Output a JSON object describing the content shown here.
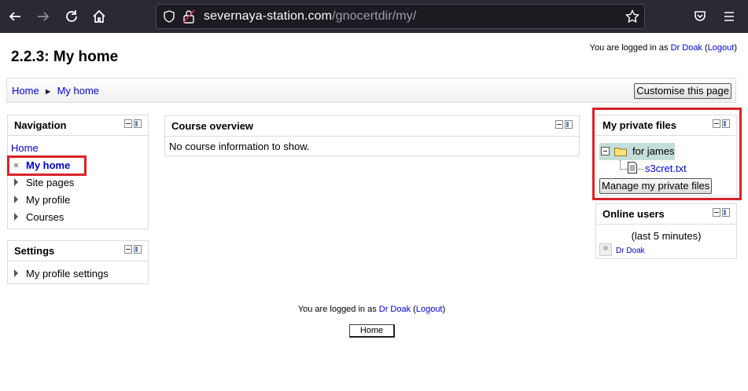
{
  "browser": {
    "url_host": "severnaya-station.com",
    "url_path": "/gnocertdir/my/",
    "icons": [
      "back-arrow-icon",
      "forward-arrow-icon",
      "reload-icon",
      "home-icon",
      "shield-icon",
      "lock-icon",
      "star-icon",
      "pocket-icon",
      "menu-icon"
    ]
  },
  "header": {
    "title": "2.2.3: My home",
    "login_prefix": "You are logged in as ",
    "user": "Dr Doak",
    "logout_open": " (",
    "logout": "Logout",
    "logout_close": ")"
  },
  "navbar": {
    "crumbs": [
      "Home",
      "My home"
    ],
    "separator": "►",
    "customise_label": "Customise this page"
  },
  "navigation_block": {
    "title": "Navigation",
    "home": "Home",
    "my_home": "My home",
    "items": [
      "Site pages",
      "My profile",
      "Courses"
    ]
  },
  "settings_block": {
    "title": "Settings",
    "items": [
      "My profile settings"
    ]
  },
  "course_overview": {
    "title": "Course overview",
    "message": "No course information to show."
  },
  "private_files": {
    "title": "My private files",
    "folder": "for james",
    "file": "s3cret.txt",
    "manage_label": "Manage my private files"
  },
  "online_users": {
    "title": "Online users",
    "subtitle": "(last 5 minutes)",
    "user": "Dr Doak"
  },
  "footer": {
    "login_prefix": "You are logged in as ",
    "user": "Dr Doak",
    "logout_open": " (",
    "logout": "Logout",
    "logout_close": ")",
    "home_label": "Home"
  },
  "colors": {
    "highlight": "#d9222a",
    "link": "#0000cc",
    "tree_highlight": "#c6dedb"
  }
}
